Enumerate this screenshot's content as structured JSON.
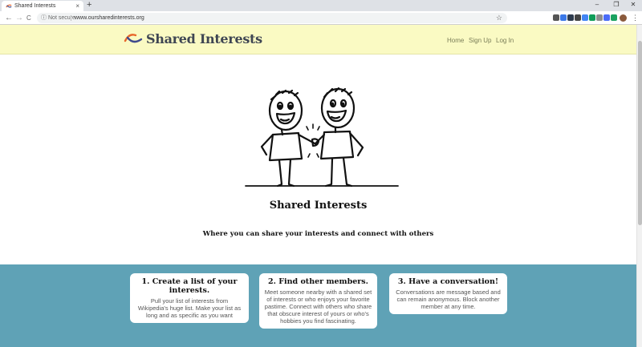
{
  "browser": {
    "tab_title": "Shared Interests",
    "tab_close": "×",
    "new_tab": "+",
    "back": "←",
    "forward": "→",
    "reload": "C",
    "security_label": "Not secure",
    "url": "www.oursharedinterests.org",
    "minimize": "–",
    "restore": "❐",
    "close": "✕",
    "menu": "⋮",
    "star": "☆",
    "info": "ⓘ",
    "extensions": [
      {
        "name": "extension-1-icon",
        "color": "#555555"
      },
      {
        "name": "extension-2-icon",
        "color": "#3b78e7"
      },
      {
        "name": "extension-3-icon",
        "color": "#2e3b4e"
      },
      {
        "name": "extension-4-icon",
        "color": "#444444"
      },
      {
        "name": "extension-5-icon",
        "color": "#4285f4"
      },
      {
        "name": "extension-6-icon",
        "color": "#0f9d58"
      },
      {
        "name": "extension-7-icon",
        "color": "#8e8e8e"
      },
      {
        "name": "extension-8-icon",
        "color": "#4a6cf7"
      },
      {
        "name": "extension-9-icon",
        "color": "#1aa260"
      }
    ]
  },
  "header": {
    "logo_text": "Shared Interests",
    "nav": [
      "Home",
      "Sign Up",
      "Log In"
    ]
  },
  "hero": {
    "title": "Shared Interests",
    "subtitle": "Where you can share your interests and connect with others"
  },
  "features": [
    {
      "title": "1. Create a list of your interests.",
      "body": "Pull your list of interests from Wikipedia's huge list. Make your list as long and as specific as you want"
    },
    {
      "title": "2. Find other members.",
      "body": "Meet someone nearby with a shared set of interests or who enjoys your favorite pastime. Connect with others who share that obscure interest of yours or who's hobbies you find fascinating."
    },
    {
      "title": "3. Have a conversation!",
      "body": "Conversations are message based and can remain anonymous. Block another member at any time."
    }
  ],
  "colors": {
    "header_bg": "#fafac3",
    "features_bg": "#5fa2b6",
    "nav_text": "#7a7e58"
  }
}
